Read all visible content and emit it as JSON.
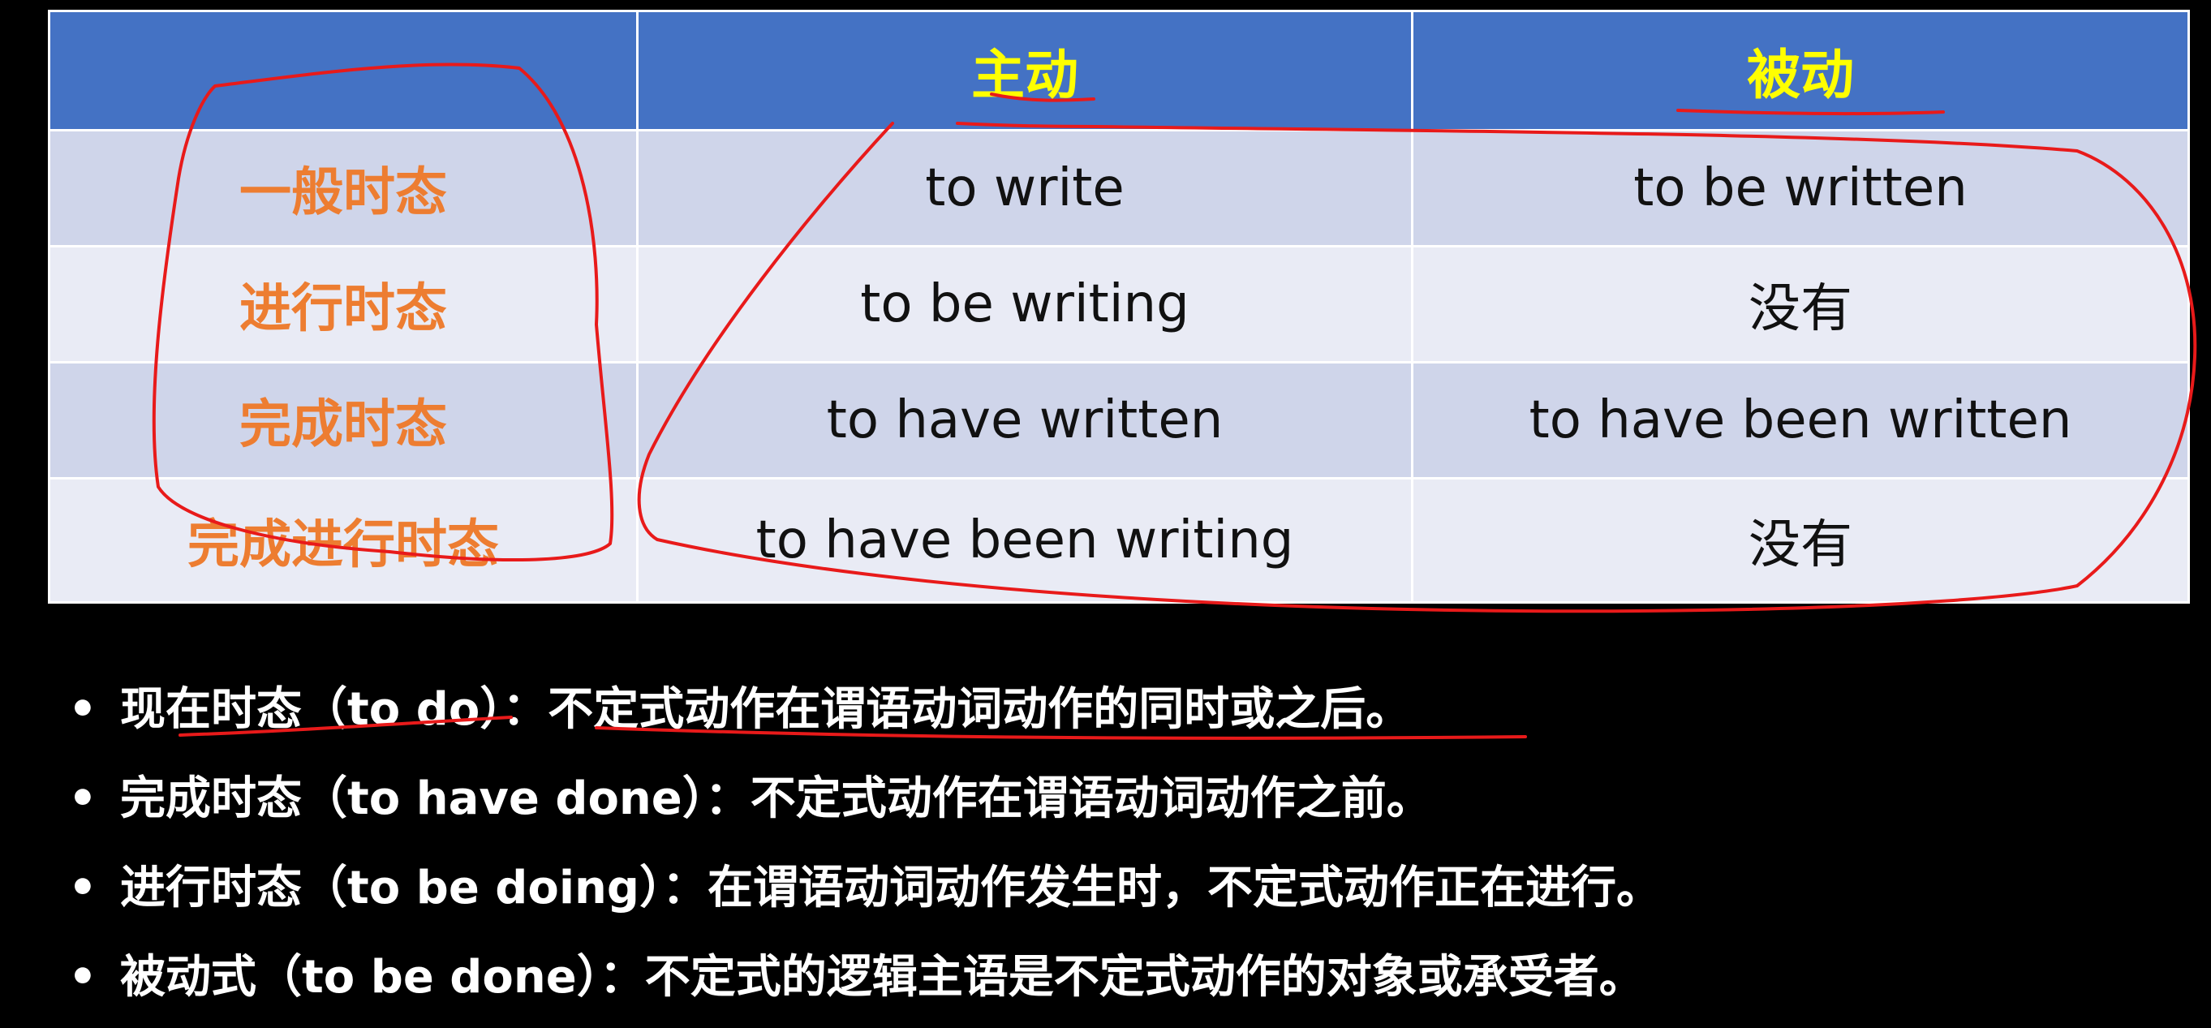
{
  "table": {
    "headers": [
      "",
      "主动",
      "被动"
    ],
    "rows": [
      {
        "label": "一般时态",
        "active": "to write",
        "passive": "to be written"
      },
      {
        "label": "进行时态",
        "active": "to be writing",
        "passive": "没有"
      },
      {
        "label": "完成时态",
        "active": "to have written",
        "passive": "to have been written"
      },
      {
        "label": "完成进行时态",
        "active": "to have been writing",
        "passive": "没有"
      }
    ]
  },
  "bullets": [
    {
      "marker": "•",
      "text": "现在时态（to do）：不定式动作在谓语动词动作的同时或之后。"
    },
    {
      "marker": "•",
      "text": "完成时态（to have done）：不定式动作在谓语动词动作之前。"
    },
    {
      "marker": "•",
      "text": "进行时态（to be doing）：在谓语动词动作发生时，不定式动作正在进行。"
    },
    {
      "marker": "•",
      "text": "被动式（to be done）：不定式的逻辑主语是不定式动作的对象或承受者。"
    }
  ],
  "colors": {
    "header_bg": "#4472C4",
    "header_text": "#FFFF00",
    "row_label_text": "#ED7D31",
    "row_odd_bg": "#CFD5EA",
    "row_even_bg": "#E9EBF5",
    "annotation_ink": "#E81A1A",
    "page_bg": "#000000"
  }
}
